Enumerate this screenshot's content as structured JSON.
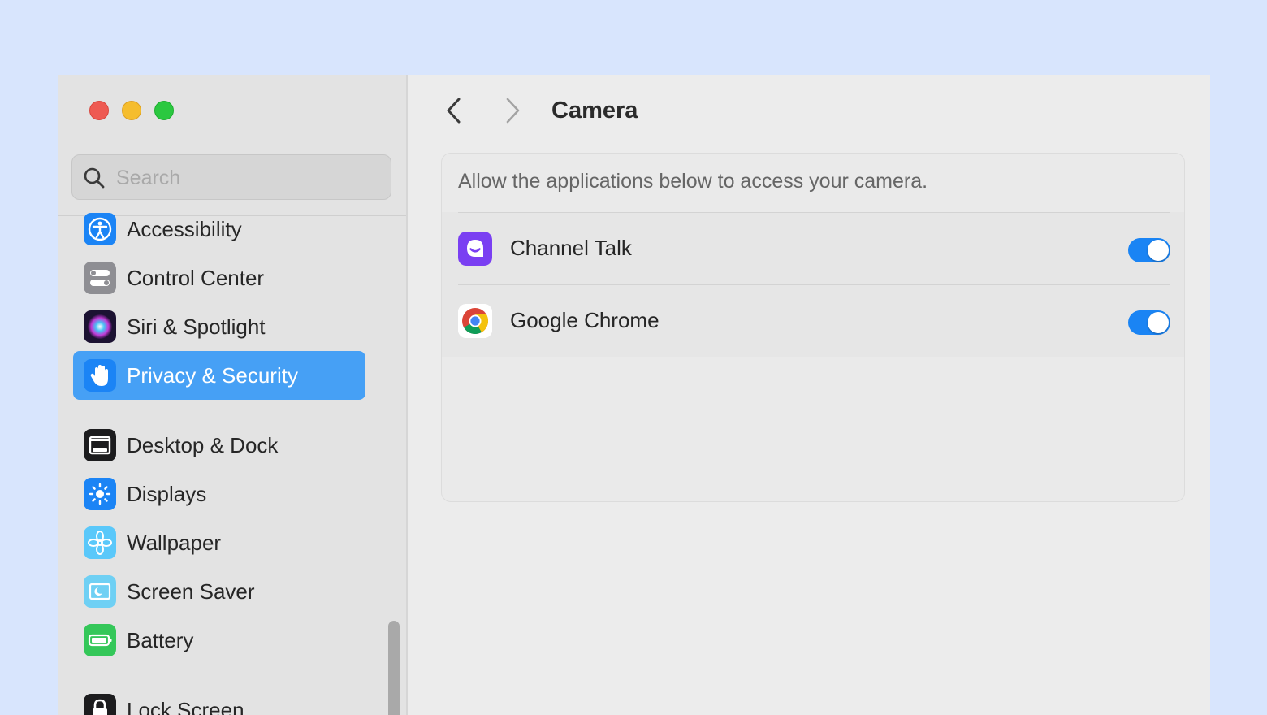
{
  "window": {
    "controls": [
      "close",
      "minimize",
      "zoom"
    ]
  },
  "sidebar": {
    "search": {
      "placeholder": "Search",
      "value": ""
    },
    "items": [
      {
        "label": "Accessibility",
        "icon": "accessibility-icon",
        "color": "#1b84f5"
      },
      {
        "label": "Control Center",
        "icon": "control-center-icon",
        "color": "#8e8e93"
      },
      {
        "label": "Siri & Spotlight",
        "icon": "siri-icon",
        "color": "#6b2fb8"
      },
      {
        "label": "Privacy & Security",
        "icon": "hand-icon",
        "color": "#1b84f5",
        "selected": true
      },
      {
        "label": "Desktop & Dock",
        "icon": "desktop-dock-icon",
        "color": "#1c1c1e"
      },
      {
        "label": "Displays",
        "icon": "displays-icon",
        "color": "#1b84f5"
      },
      {
        "label": "Wallpaper",
        "icon": "wallpaper-icon",
        "color": "#5ac8fa"
      },
      {
        "label": "Screen Saver",
        "icon": "screen-saver-icon",
        "color": "#6fd0f4"
      },
      {
        "label": "Battery",
        "icon": "battery-icon",
        "color": "#34c759"
      },
      {
        "label": "Lock Screen",
        "icon": "lock-icon",
        "color": "#1c1c1e"
      }
    ]
  },
  "main": {
    "title": "Camera",
    "description": "Allow the applications below to access your camera.",
    "apps": [
      {
        "name": "Channel Talk",
        "icon": "channel-talk-icon",
        "enabled": true
      },
      {
        "name": "Google Chrome",
        "icon": "chrome-icon",
        "enabled": true
      }
    ]
  },
  "colors": {
    "accent": "#1a84f4",
    "selection": "#46a0f5",
    "background": "#d8e5fd"
  }
}
